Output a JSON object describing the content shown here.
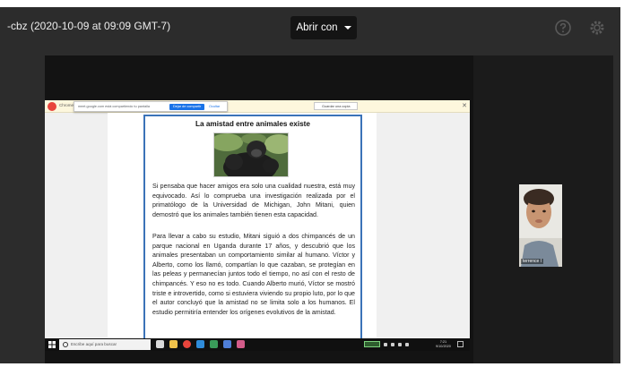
{
  "viewer": {
    "file_title": "-cbz (2020-10-09 at 09:09 GMT-7)",
    "open_with_label": "Abrir con",
    "icons": [
      "caret-down-icon",
      "help-icon",
      "settings-icon"
    ]
  },
  "shared_screen": {
    "notice_text": "Chrome está compartiendo tu pantalla",
    "share_popup": {
      "text": "meet.google.com está compartiendo tu pantalla",
      "stop_label": "Dejar de compartir",
      "hide_label": "Ocultar"
    },
    "notice_action_label": "Guardar una copia"
  },
  "document": {
    "title": "La amistad entre animales existe",
    "paragraphs": [
      "Si pensaba que hacer amigos era solo una cualidad nuestra, está muy equivocado. Así lo comprueba una investigación realizada por el primatólogo de la Universidad de Michigan, John Mitani, quien demostró que los animales también tienen esta capacidad.",
      "Para llevar a cabo su estudio, Mitani siguió a dos chimpancés de un parque nacional en Uganda durante 17 años, y descubrió que los animales presentaban un comportamiento similar al humano. Víctor y Alberto, como los llamó, compartían lo que cazaban, se protegían en las peleas y permanecían juntos todo el tiempo, no así con el resto de chimpancés. Y eso no es todo. Cuando Alberto murió, Víctor se mostró triste e introvertido, como si estuviera viviendo su propio luto, por lo que el autor concluyó que la amistad no se limita solo a los humanos. El estudio permitiría entender los orígenes evolutivos de la amistad."
    ]
  },
  "taskbar": {
    "search_placeholder": "Escribe aquí para buscar",
    "clock_time": "7:21",
    "clock_date": "9/10/2020",
    "app_icons": [
      "task-view-icon",
      "file-explorer-icon",
      "chrome-icon",
      "edge-icon",
      "store-icon",
      "mail-icon",
      "app-icon"
    ]
  },
  "participant": {
    "name": "terrence l"
  },
  "colors": {
    "viewer_background": "#2c2c2c",
    "doc_border": "#3b73b8",
    "stop_sharing_button": "#1a73e8"
  }
}
